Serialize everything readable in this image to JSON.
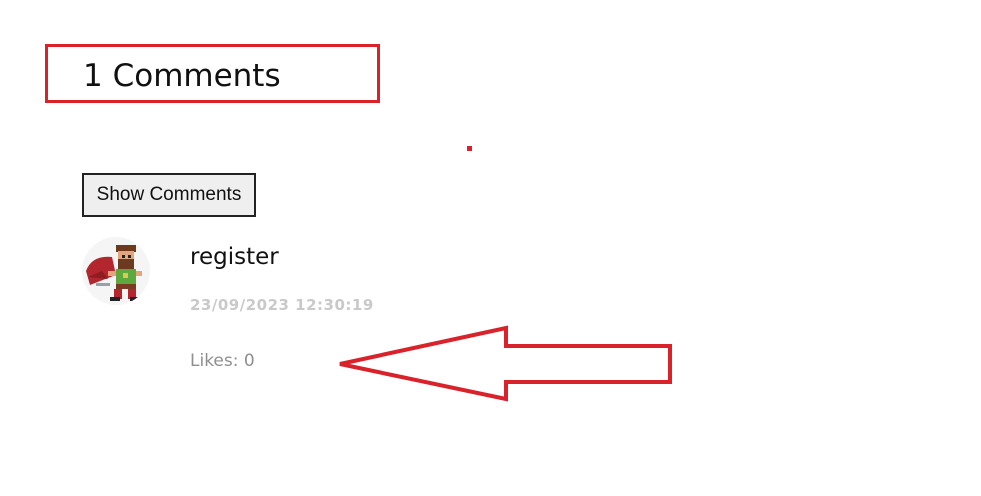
{
  "comments": {
    "title": "1 Comments",
    "show_button_label": "Show Comments",
    "items": [
      {
        "username": "register",
        "timestamp": "23/09/2023 12:30:19",
        "likes": "Likes: 0",
        "avatar_icon": "pixel-hero-avatar-icon"
      }
    ]
  },
  "annotations": {
    "highlight_color": "#d9222a",
    "arrow_icon": "left-arrow-icon"
  }
}
